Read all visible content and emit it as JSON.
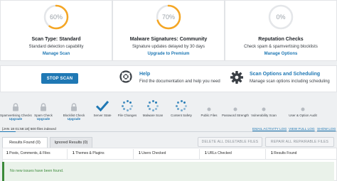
{
  "cards": [
    {
      "percent": "60%",
      "title": "Scan Type: Standard",
      "subtitle": "Standard detection capability",
      "link": "Manage Scan",
      "progress": 0.6
    },
    {
      "percent": "70%",
      "title": "Malware Signatures: Community",
      "subtitle": "Signature updates delayed by 30 days",
      "link": "Upgrade to Premium",
      "progress": 0.7
    },
    {
      "percent": "0%",
      "title": "Reputation Checks",
      "subtitle": "Check spam & spamvertising blocklists",
      "link": "Manage Options",
      "progress": 0
    }
  ],
  "actions": {
    "stop_scan": "STOP SCAN",
    "help_title": "Help",
    "help_text": "Find the documentation and help you need",
    "options_title": "Scan Options and Scheduling",
    "options_text": "Manage scan options including scheduling"
  },
  "stages": [
    {
      "label": "Spamvertising Checks",
      "sub": "Upgrade",
      "state": "locked"
    },
    {
      "label": "Spam Check",
      "sub": "Upgrade",
      "state": "locked"
    },
    {
      "label": "Blocklist Check",
      "sub": "Upgrade",
      "state": "locked"
    },
    {
      "label": "Server State",
      "sub": "",
      "state": "done"
    },
    {
      "label": "File Changes",
      "sub": "",
      "state": "running"
    },
    {
      "label": "Malware Scan",
      "sub": "",
      "state": "running"
    },
    {
      "label": "Content Safety",
      "sub": "",
      "state": "running"
    },
    {
      "label": "Public Files",
      "sub": "",
      "state": "pending"
    },
    {
      "label": "Password Strength",
      "sub": "",
      "state": "pending"
    },
    {
      "label": "Vulnerability Scan",
      "sub": "",
      "state": "pending"
    },
    {
      "label": "User & Option Audit",
      "sub": "",
      "state": "pending"
    }
  ],
  "log": {
    "line": "[JAN 18 01:58:18] 500 files indexed",
    "email": "EMAIL ACTIVITY LOG",
    "full": "VIEW FULL LOG",
    "show": "SHOW LOG"
  },
  "results": {
    "tab_found": "Results Found (0)",
    "tab_ignored": "Ignored Results (0)",
    "delete_btn": "DELETE ALL DELETABLE FILES",
    "repair_btn": "REPAIR ALL REPAIRABLE FILES",
    "stats": [
      {
        "value": "1",
        "label": "Posts, Comments, & Files"
      },
      {
        "value": "1",
        "label": "Themes & Plugins"
      },
      {
        "value": "1",
        "label": "Users Checked"
      },
      {
        "value": "1",
        "label": "URLs Checked"
      },
      {
        "value": "1",
        "label": "Results Found"
      }
    ],
    "empty_message": "No new issues have been found."
  },
  "colors": {
    "accent": "#1f78b4",
    "ring": "#f5a623",
    "success": "#3c8a3a"
  }
}
